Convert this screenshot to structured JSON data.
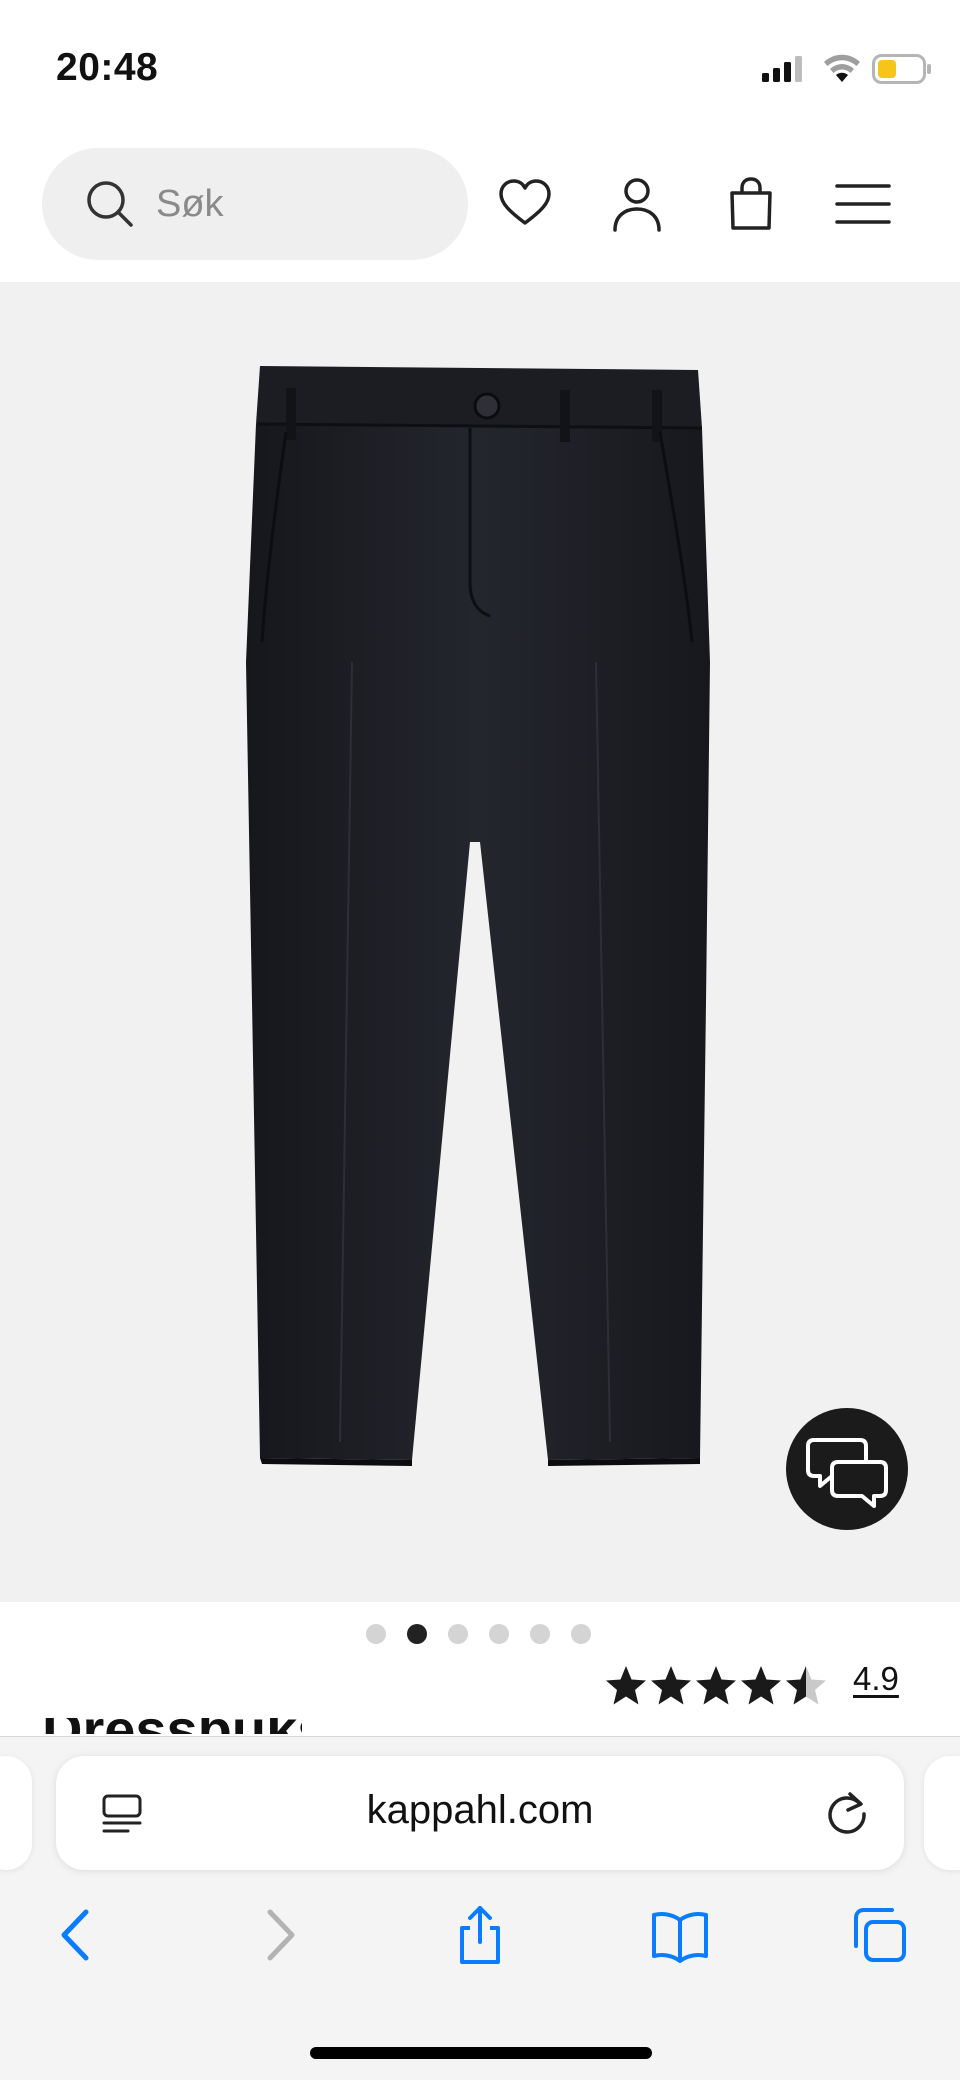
{
  "status_bar": {
    "time": "20:48",
    "signal_icon": "cellular-signal-icon",
    "wifi_icon": "wifi-icon",
    "battery_icon": "battery-low-icon",
    "battery_color": "#f5c518"
  },
  "header": {
    "search": {
      "placeholder": "Søk",
      "icon": "search-icon"
    },
    "icons": [
      "heart-icon",
      "user-icon",
      "shopping-bag-icon",
      "hamburger-menu-icon"
    ]
  },
  "product": {
    "image_subject": "black tailored trousers",
    "image_count": 6,
    "active_image": 2,
    "rating": {
      "value": "4.9",
      "stars_filled": 4.5,
      "stars_total": 5
    },
    "chat_icon": "chat-bubbles-icon",
    "title_partial": "Dressbukse"
  },
  "browser": {
    "url": "kappahl.com",
    "icons": [
      "reader-mode-icon",
      "reload-icon",
      "back-icon",
      "forward-icon",
      "share-icon",
      "bookmarks-icon",
      "tabs-icon"
    ],
    "accent_color": "#0a7cff"
  }
}
